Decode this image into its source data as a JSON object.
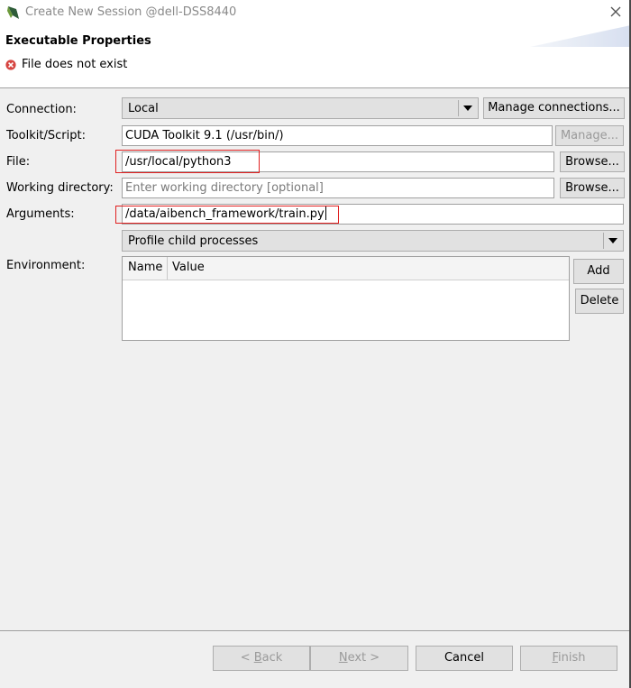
{
  "window": {
    "title": "Create New Session @dell-DSS8440"
  },
  "header": {
    "title": "Executable Properties",
    "error": "File does not exist"
  },
  "form": {
    "connection": {
      "label": "Connection:",
      "value": "Local",
      "manage_button": "Manage connections..."
    },
    "toolkit": {
      "label": "Toolkit/Script:",
      "value": "CUDA Toolkit 9.1 (/usr/bin/)",
      "manage_button": "Manage..."
    },
    "file": {
      "label": "File:",
      "value": "/usr/local/python3",
      "browse_button": "Browse..."
    },
    "working_directory": {
      "label": "Working directory:",
      "placeholder": "Enter working directory [optional]",
      "browse_button": "Browse..."
    },
    "arguments": {
      "label": "Arguments:",
      "value": "/data/aibench_framework/train.py"
    },
    "profile": {
      "value": "Profile child processes"
    },
    "environment": {
      "label": "Environment:",
      "columns": [
        "Name",
        "Value"
      ],
      "rows": [],
      "add_button": "Add",
      "delete_button": "Delete"
    }
  },
  "footer": {
    "back": {
      "prefix": "< ",
      "mnemonic": "B",
      "rest": "ack"
    },
    "next": {
      "mnemonic": "N",
      "rest": "ext >"
    },
    "cancel": "Cancel",
    "finish": {
      "mnemonic": "F",
      "rest": "inish"
    }
  },
  "colors": {
    "highlight_box": "#e02020",
    "error_icon": "#d64541",
    "panel_bg": "#f0f0f0"
  }
}
